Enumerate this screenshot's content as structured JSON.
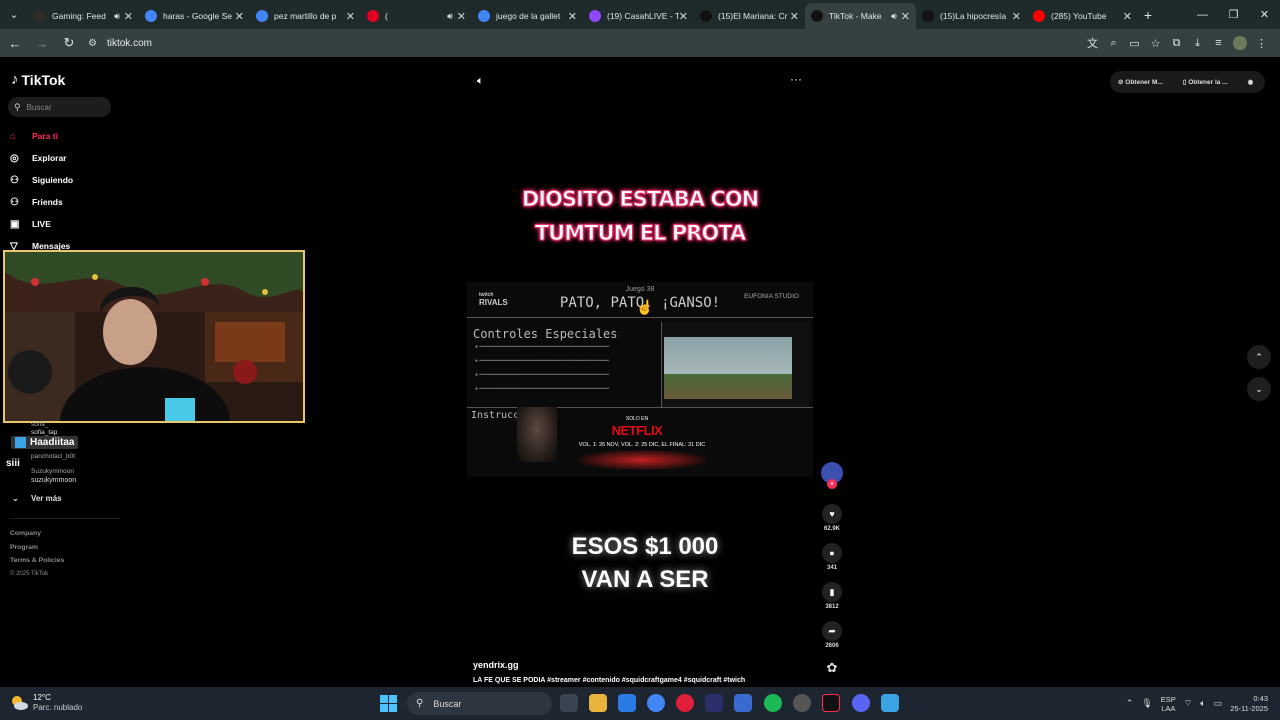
{
  "browser": {
    "tabs": [
      {
        "title": "Gaming: Feed",
        "audio": true,
        "color": "#2c2c2c",
        "active": false
      },
      {
        "title": "haras - Google Se",
        "audio": false,
        "color": "#4285f4",
        "active": false
      },
      {
        "title": "pez martillo de p",
        "audio": false,
        "color": "#4285f4",
        "active": false
      },
      {
        "title": "(",
        "audio": true,
        "color": "#e60023",
        "active": false
      },
      {
        "title": "juego de la gallet",
        "audio": false,
        "color": "#4285f4",
        "active": false
      },
      {
        "title": "(19) CasahLIVE - T",
        "audio": false,
        "color": "#9146ff",
        "active": false
      },
      {
        "title": "(15)El Mariana: Cr",
        "audio": false,
        "color": "#111111",
        "active": false
      },
      {
        "title": "TikTok - Make",
        "audio": true,
        "color": "#111111",
        "active": true
      },
      {
        "title": "(15)La hipocresía",
        "audio": false,
        "color": "#111111",
        "active": false
      },
      {
        "title": "(285) YouTube",
        "audio": false,
        "color": "#ff0000",
        "active": false
      }
    ],
    "url": "tiktok.com"
  },
  "sidebar": {
    "logo": "TikTok",
    "search_placeholder": "Buscar",
    "items": [
      {
        "label": "Para ti",
        "icon": "home-icon",
        "active": true
      },
      {
        "label": "Explorar",
        "icon": "compass-icon",
        "active": false
      },
      {
        "label": "Siguiendo",
        "icon": "following-icon",
        "active": false
      },
      {
        "label": "Friends",
        "icon": "friends-icon",
        "active": false
      },
      {
        "label": "LIVE",
        "icon": "live-icon",
        "active": false
      },
      {
        "label": "Mensajes",
        "icon": "messages-icon",
        "active": false
      }
    ],
    "following": {
      "partial_1": "sofia_",
      "partial_2": "sofia_tap",
      "hadi": "Haadiitaa",
      "hadi_sub": "panchotaci_b0t",
      "siii": "siii",
      "suzu_small": "Suzukymmoon",
      "suzu": "suzukymmoon"
    },
    "ver_mas": "Ver más",
    "footer": [
      "Company",
      "Program",
      "Terms & Policies"
    ],
    "copyright": "© 2025 TikTok"
  },
  "video": {
    "caption_line1": "DIOSITO ESTABA CON",
    "caption_line2": "TUMTUM EL PROTA",
    "slide": {
      "brand_left_1": "twitch",
      "brand_left_2": "RIVALS",
      "game_no": "Juego 38",
      "game_title": "PATO, PATO, ¡GANSO!",
      "brand_right": "EUFONIA STUDIO",
      "controls": "Controles Especiales",
      "instructions": "Instrucciones"
    },
    "netflix": {
      "solo": "SOLO EN",
      "brand": "NETFLIX",
      "dates": "VOL. 1: 26 NOV, VOL. 2: 25 DIC, EL FINAL: 31 DIC"
    },
    "big_line1": "ESOS $1 000",
    "big_line2": "VAN A SER",
    "author": "yendrix.gg",
    "description": "LA FE QUE SE PODIA #streamer #contenido #squidcraftgame4 #squidcraft #twich",
    "progress": 0.12
  },
  "actions": {
    "likes": "62.9K",
    "comments": "341",
    "saves": "3812",
    "shares": "2606"
  },
  "top_right": {
    "btn1": "Obtener M...",
    "btn2": "Obtener la ..."
  },
  "taskbar": {
    "temp": "12°C",
    "weather": "Parc. nublado",
    "search": "Buscar",
    "lang1": "ESP",
    "lang2": "LAA",
    "time": "0:43",
    "date": "25-11-2025"
  }
}
